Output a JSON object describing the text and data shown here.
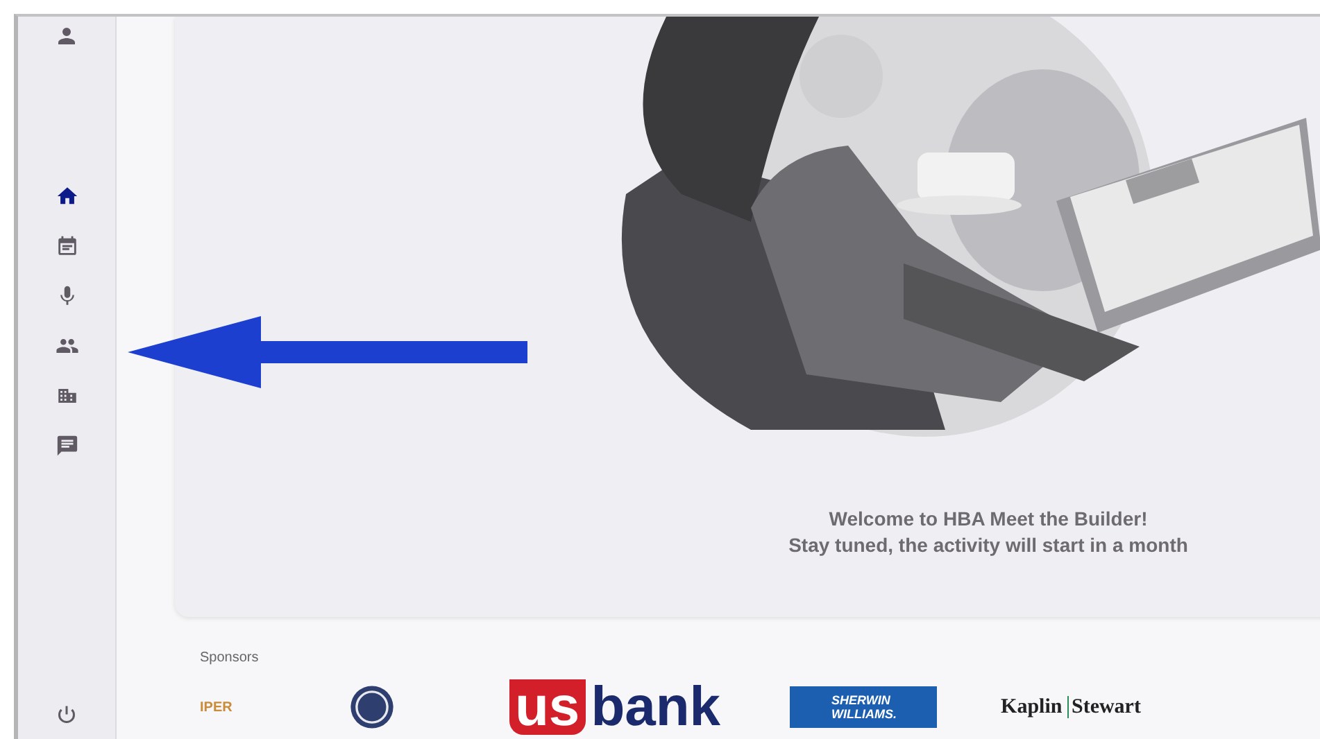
{
  "sidebar": {
    "nav_items": [
      {
        "selected": true
      },
      {
        "selected": false
      },
      {
        "selected": false
      },
      {
        "selected": false
      },
      {
        "selected": false
      },
      {
        "selected": false
      }
    ]
  },
  "welcome": {
    "title": "Welcome to HBA Meet the Builder!",
    "subtitle": "Stay tuned, the activity will start in a month"
  },
  "sponsors": {
    "label": "Sponsors",
    "logos": [
      {
        "kind": "text",
        "text": "IPER"
      },
      {
        "kind": "ge"
      },
      {
        "kind": "usbank",
        "text_a": "us",
        "text_b": "bank"
      },
      {
        "kind": "sherwin",
        "text": "SHERWIN WILLIAMS."
      },
      {
        "kind": "kaplin",
        "text_a": "Kaplin",
        "text_b": "Stewart"
      }
    ]
  }
}
